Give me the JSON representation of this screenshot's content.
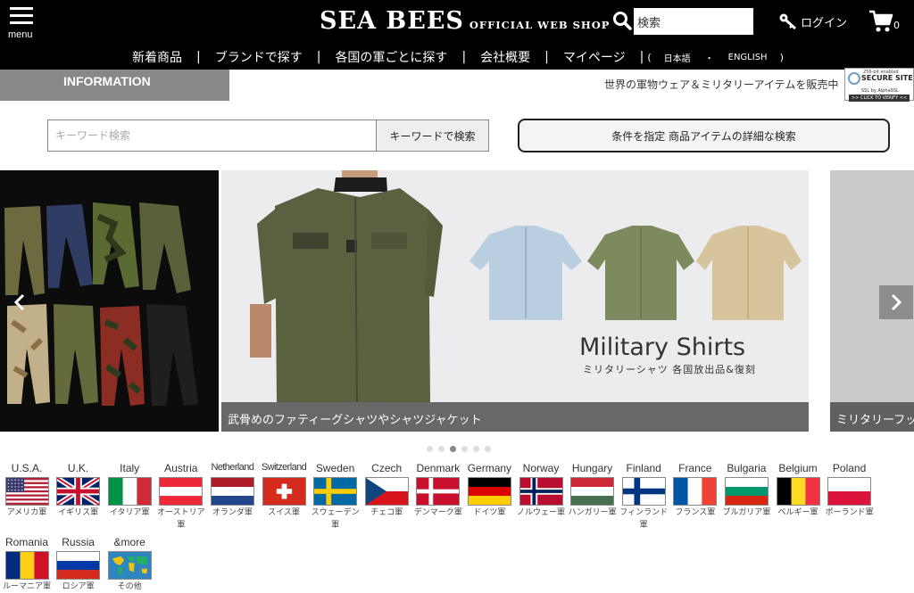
{
  "header": {
    "menu_label": "menu",
    "logo_main": "SEA BEES",
    "logo_sub": "OFFICIAL WEB SHOP",
    "search_value": "検索",
    "login_label": "ログイン",
    "cart_count": "0"
  },
  "nav": {
    "items": [
      "新着商品",
      "ブランドで探す",
      "各国の軍ごとに探す",
      "会社概要",
      "マイページ"
    ],
    "separator": "|",
    "lang_open": "(",
    "lang_ja": "日本語",
    "lang_dot": "・",
    "lang_en": "ENGLISH",
    "lang_close": ")"
  },
  "info": {
    "tab_label": "INFORMATION",
    "tagline": "世界の軍物ウェア＆ミリタリーアイテムを販売中",
    "ssl_line1": "256-bit enabled",
    "ssl_line2": "SECURE SITE",
    "ssl_line3": "SSL by AlphaSSL",
    "ssl_line4": ">> CLICK TO VERIFY <<"
  },
  "search": {
    "placeholder": "キーワード検索",
    "button_label": "キーワードで検索",
    "advanced_label": "条件を指定 商品アイテムの詳細な検索"
  },
  "carousel": {
    "main_caption": "武骨めのファティーグシャツやシャツジャケット",
    "main_title": "Military Shirts",
    "main_subtitle": "ミリタリーシャツ 各国放出品&復刻",
    "right_caption": "ミリタリーフット",
    "dot_count": 6,
    "active_dot": 2
  },
  "flags": [
    {
      "en": "U.S.A.",
      "jp": "アメリカ軍",
      "icon": "usa-flag-icon"
    },
    {
      "en": "U.K.",
      "jp": "イギリス軍",
      "icon": "uk-flag-icon"
    },
    {
      "en": "Italy",
      "jp": "イタリア軍",
      "icon": "italy-flag-icon"
    },
    {
      "en": "Austria",
      "jp": "オーストリア軍",
      "icon": "austria-flag-icon"
    },
    {
      "en": "Netherland",
      "jp": "オランダ軍",
      "icon": "netherlands-flag-icon"
    },
    {
      "en": "Switzerland",
      "jp": "スイス軍",
      "icon": "switzerland-flag-icon"
    },
    {
      "en": "Sweden",
      "jp": "スウェーデン軍",
      "icon": "sweden-flag-icon"
    },
    {
      "en": "Czech",
      "jp": "チェコ軍",
      "icon": "czech-flag-icon"
    },
    {
      "en": "Denmark",
      "jp": "デンマーク軍",
      "icon": "denmark-flag-icon"
    },
    {
      "en": "Germany",
      "jp": "ドイツ軍",
      "icon": "germany-flag-icon"
    },
    {
      "en": "Norway",
      "jp": "ノルウェー軍",
      "icon": "norway-flag-icon"
    },
    {
      "en": "Hungary",
      "jp": "ハンガリー軍",
      "icon": "hungary-flag-icon"
    },
    {
      "en": "Finland",
      "jp": "フィンランド軍",
      "icon": "finland-flag-icon"
    },
    {
      "en": "France",
      "jp": "フランス軍",
      "icon": "france-flag-icon"
    },
    {
      "en": "Bulgaria",
      "jp": "ブルガリア軍",
      "icon": "bulgaria-flag-icon"
    },
    {
      "en": "Belgium",
      "jp": "ベルギー軍",
      "icon": "belgium-flag-icon"
    },
    {
      "en": "Poland",
      "jp": "ポーランド軍",
      "icon": "poland-flag-icon"
    },
    {
      "en": "Romania",
      "jp": "ルーマニア軍",
      "icon": "romania-flag-icon"
    },
    {
      "en": "Russia",
      "jp": "ロシア軍",
      "icon": "russia-flag-icon"
    },
    {
      "en": "&more",
      "jp": "その他",
      "icon": "world-map-icon"
    }
  ]
}
